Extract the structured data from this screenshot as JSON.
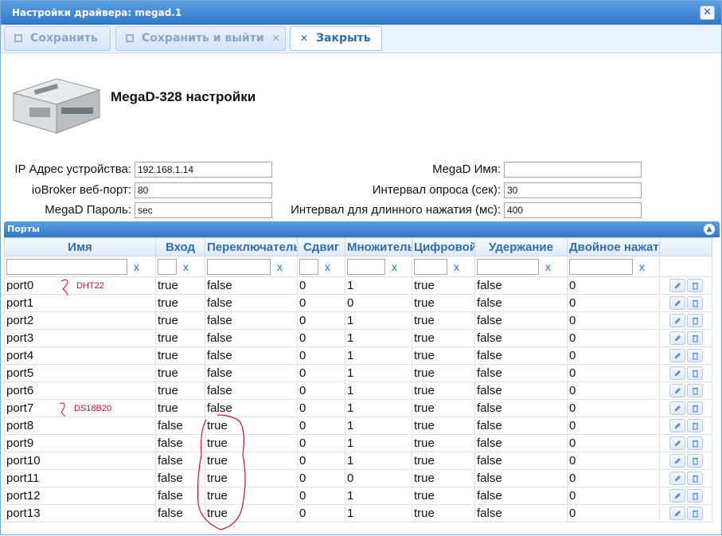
{
  "window": {
    "title": "Настройки драйвера: megad.1",
    "close_glyph": "✕"
  },
  "toolbar": {
    "save": "Сохранить",
    "save_exit": "Сохранить и выйти",
    "close": "Закрыть",
    "x_glyph": "✕"
  },
  "page": {
    "heading": "MegaD-328 настройки"
  },
  "form": {
    "ip_label": "IP Адрес устройства:",
    "ip_value": "192.168.1.14",
    "port_label": "ioBroker веб-порт:",
    "port_value": "80",
    "password_label": "MegaD Пароль:",
    "password_value": "sec",
    "name_label": "MegaD Имя:",
    "name_value": "",
    "poll_label": "Интервал опроса (сек):",
    "poll_value": "30",
    "longpress_label": "Интервал для длинного нажатия (мс):",
    "longpress_value": "400"
  },
  "ports_panel": {
    "title": "Порты",
    "collapse_glyph": "▲",
    "clear_glyph": "x",
    "columns": [
      "Имя",
      "Вход",
      "Переключатель",
      "Сдвиг",
      "Множитель",
      "Цифровой",
      "Удержание",
      "Двойное нажатие"
    ],
    "rows": [
      [
        "port0",
        "true",
        "false",
        "0",
        "1",
        "true",
        "false",
        "0"
      ],
      [
        "port1",
        "true",
        "false",
        "0",
        "0",
        "true",
        "false",
        "0"
      ],
      [
        "port2",
        "true",
        "false",
        "0",
        "1",
        "true",
        "false",
        "0"
      ],
      [
        "port3",
        "true",
        "false",
        "0",
        "1",
        "true",
        "false",
        "0"
      ],
      [
        "port4",
        "true",
        "false",
        "0",
        "1",
        "true",
        "false",
        "0"
      ],
      [
        "port5",
        "true",
        "false",
        "0",
        "1",
        "true",
        "false",
        "0"
      ],
      [
        "port6",
        "true",
        "false",
        "0",
        "1",
        "true",
        "false",
        "0"
      ],
      [
        "port7",
        "true",
        "false",
        "0",
        "1",
        "true",
        "false",
        "0"
      ],
      [
        "port8",
        "false",
        "true",
        "0",
        "1",
        "true",
        "false",
        "0"
      ],
      [
        "port9",
        "false",
        "true",
        "0",
        "1",
        "true",
        "false",
        "0"
      ],
      [
        "port10",
        "false",
        "true",
        "0",
        "1",
        "true",
        "false",
        "0"
      ],
      [
        "port11",
        "false",
        "true",
        "0",
        "0",
        "true",
        "false",
        "0"
      ],
      [
        "port12",
        "false",
        "true",
        "0",
        "1",
        "true",
        "false",
        "0"
      ],
      [
        "port13",
        "false",
        "true",
        "0",
        "1",
        "true",
        "false",
        "0"
      ]
    ]
  },
  "annotations": {
    "port0": "DHT22",
    "port7": "DS18B20"
  },
  "colors": {
    "title_bar": "#2f78c9",
    "header_text": "#2e6eb2",
    "annotation": "#c8102e"
  }
}
